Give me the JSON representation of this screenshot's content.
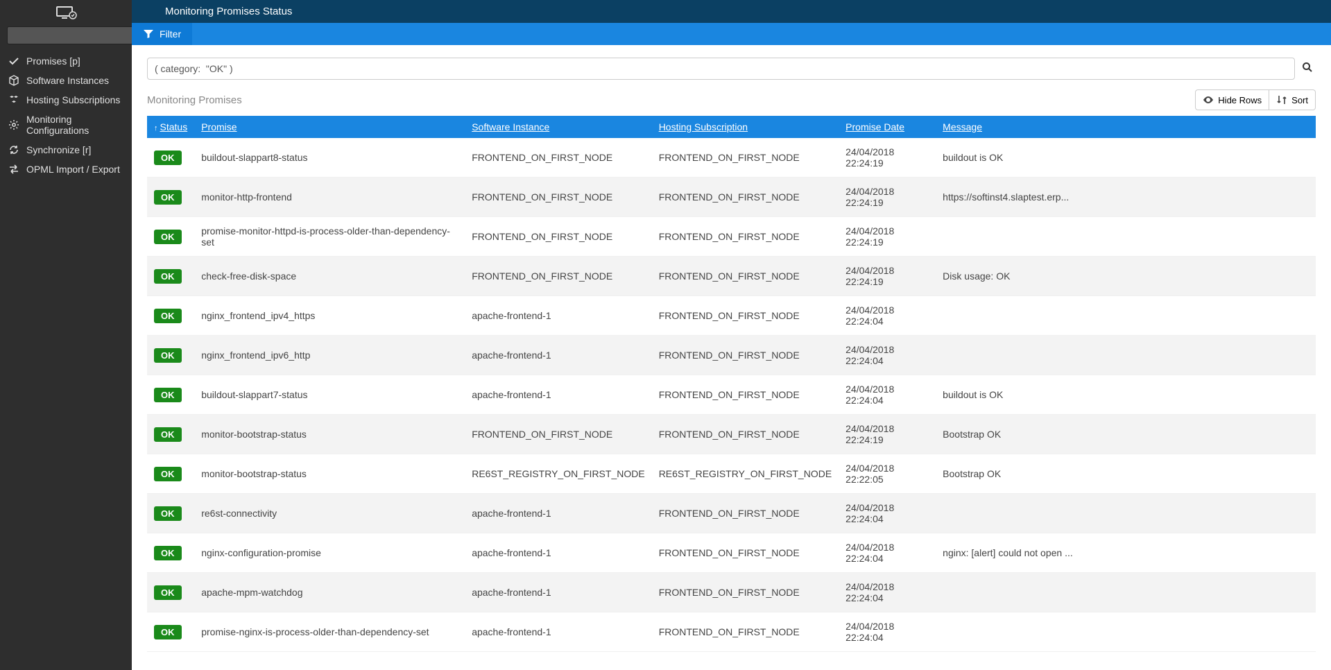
{
  "header": {
    "title": "Monitoring Promises Status"
  },
  "filter": {
    "label": "Filter"
  },
  "sidebar": {
    "search_placeholder": "",
    "items": [
      {
        "label": "Promises [p]",
        "icon": "check-icon"
      },
      {
        "label": "Software Instances",
        "icon": "cube-icon"
      },
      {
        "label": "Hosting Subscriptions",
        "icon": "cubes-icon"
      },
      {
        "label": "Monitoring Configurations",
        "icon": "gear-icon"
      },
      {
        "label": "Synchronize [r]",
        "icon": "refresh-icon"
      },
      {
        "label": "OPML Import / Export",
        "icon": "exchange-icon"
      }
    ]
  },
  "search": {
    "value": "( category:  \"OK\" )"
  },
  "listing": {
    "title": "Monitoring Promises",
    "hide_rows": "Hide Rows",
    "sort": "Sort"
  },
  "columns": {
    "status": "Status",
    "promise": "Promise",
    "software_instance": "Software Instance",
    "hosting_subscription": "Hosting Subscription",
    "promise_date": "Promise Date",
    "message": "Message"
  },
  "rows": [
    {
      "status": "OK",
      "promise": "buildout-slappart8-status",
      "instance": "FRONTEND_ON_FIRST_NODE",
      "hosting": "FRONTEND_ON_FIRST_NODE",
      "date": "24/04/2018 22:24:19",
      "message": "buildout is OK"
    },
    {
      "status": "OK",
      "promise": "monitor-http-frontend",
      "instance": "FRONTEND_ON_FIRST_NODE",
      "hosting": "FRONTEND_ON_FIRST_NODE",
      "date": "24/04/2018 22:24:19",
      "message": "https://softinst4.slaptest.erp..."
    },
    {
      "status": "OK",
      "promise": "promise-monitor-httpd-is-process-older-than-dependency-set",
      "instance": "FRONTEND_ON_FIRST_NODE",
      "hosting": "FRONTEND_ON_FIRST_NODE",
      "date": "24/04/2018 22:24:19",
      "message": ""
    },
    {
      "status": "OK",
      "promise": "check-free-disk-space",
      "instance": "FRONTEND_ON_FIRST_NODE",
      "hosting": "FRONTEND_ON_FIRST_NODE",
      "date": "24/04/2018 22:24:19",
      "message": "Disk usage: OK"
    },
    {
      "status": "OK",
      "promise": "nginx_frontend_ipv4_https",
      "instance": "apache-frontend-1",
      "hosting": "FRONTEND_ON_FIRST_NODE",
      "date": "24/04/2018 22:24:04",
      "message": ""
    },
    {
      "status": "OK",
      "promise": "nginx_frontend_ipv6_http",
      "instance": "apache-frontend-1",
      "hosting": "FRONTEND_ON_FIRST_NODE",
      "date": "24/04/2018 22:24:04",
      "message": ""
    },
    {
      "status": "OK",
      "promise": "buildout-slappart7-status",
      "instance": "apache-frontend-1",
      "hosting": "FRONTEND_ON_FIRST_NODE",
      "date": "24/04/2018 22:24:04",
      "message": "buildout is OK"
    },
    {
      "status": "OK",
      "promise": "monitor-bootstrap-status",
      "instance": "FRONTEND_ON_FIRST_NODE",
      "hosting": "FRONTEND_ON_FIRST_NODE",
      "date": "24/04/2018 22:24:19",
      "message": "Bootstrap OK"
    },
    {
      "status": "OK",
      "promise": "monitor-bootstrap-status",
      "instance": "RE6ST_REGISTRY_ON_FIRST_NODE",
      "hosting": "RE6ST_REGISTRY_ON_FIRST_NODE",
      "date": "24/04/2018 22:22:05",
      "message": "Bootstrap OK"
    },
    {
      "status": "OK",
      "promise": "re6st-connectivity",
      "instance": "apache-frontend-1",
      "hosting": "FRONTEND_ON_FIRST_NODE",
      "date": "24/04/2018 22:24:04",
      "message": ""
    },
    {
      "status": "OK",
      "promise": "nginx-configuration-promise",
      "instance": "apache-frontend-1",
      "hosting": "FRONTEND_ON_FIRST_NODE",
      "date": "24/04/2018 22:24:04",
      "message": "nginx: [alert] could not open ..."
    },
    {
      "status": "OK",
      "promise": "apache-mpm-watchdog",
      "instance": "apache-frontend-1",
      "hosting": "FRONTEND_ON_FIRST_NODE",
      "date": "24/04/2018 22:24:04",
      "message": ""
    },
    {
      "status": "OK",
      "promise": "promise-nginx-is-process-older-than-dependency-set",
      "instance": "apache-frontend-1",
      "hosting": "FRONTEND_ON_FIRST_NODE",
      "date": "24/04/2018 22:24:04",
      "message": ""
    }
  ],
  "icons": {
    "check-icon": "✔",
    "cube-icon": "⬣",
    "cubes-icon": "⬢",
    "gear-icon": "⚙",
    "refresh-icon": "↻",
    "exchange-icon": "⇄",
    "search-icon": "🔍",
    "filter-icon": "▼",
    "eye-icon": "👁",
    "sort-icon": "⇅"
  }
}
